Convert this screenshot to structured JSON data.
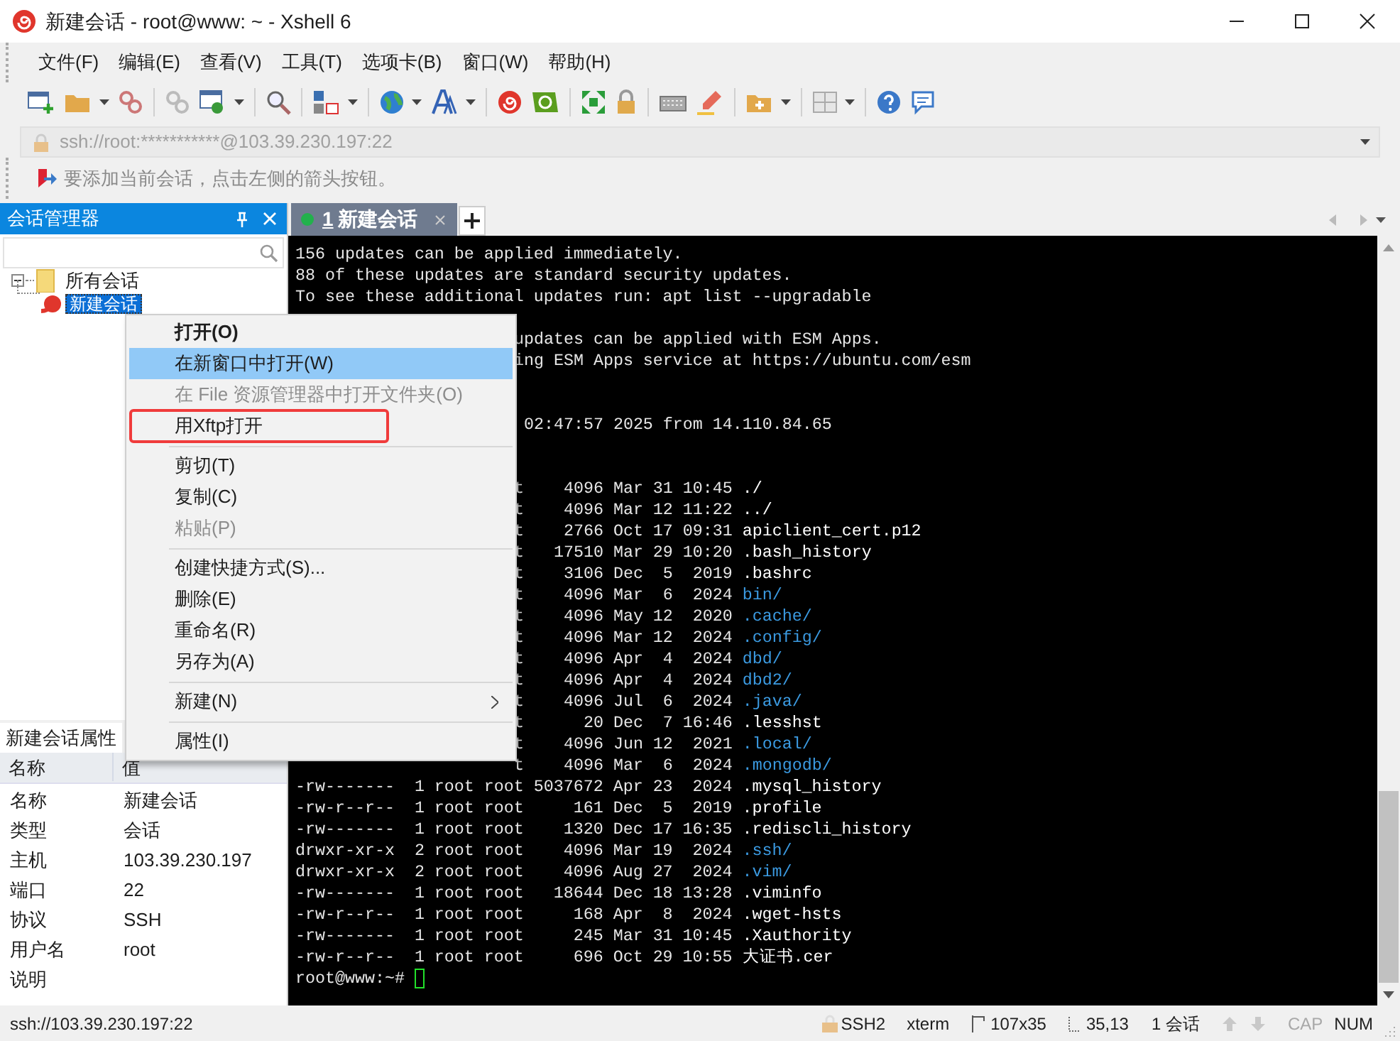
{
  "window": {
    "title": "新建会话 - root@www: ~ - Xshell 6"
  },
  "menu_bar": [
    "文件(F)",
    "编辑(E)",
    "查看(V)",
    "工具(T)",
    "选项卡(B)",
    "窗口(W)",
    "帮助(H)"
  ],
  "address_bar": {
    "value": "ssh://root:***********@103.39.230.197:22"
  },
  "hint_bar": {
    "text": "要添加当前会话，点击左侧的箭头按钮。"
  },
  "session_manager": {
    "title": "会话管理器",
    "tree": [
      {
        "label": "所有会话",
        "expanded": true,
        "selected": false,
        "children": [
          {
            "label": "新建会话",
            "selected": true
          }
        ]
      }
    ]
  },
  "properties": {
    "tab": "新建会话属性",
    "columns": [
      "名称",
      "值"
    ],
    "rows": [
      {
        "name": "名称",
        "value": "新建会话"
      },
      {
        "name": "类型",
        "value": "会话"
      },
      {
        "name": "主机",
        "value": "103.39.230.197"
      },
      {
        "name": "端口",
        "value": "22"
      },
      {
        "name": "协议",
        "value": "SSH"
      },
      {
        "name": "用户名",
        "value": "root"
      },
      {
        "name": "说明"
      }
    ]
  },
  "tabs": [
    {
      "number": "1",
      "label": "新建会话",
      "selected": true,
      "connected": true
    }
  ],
  "terminal": {
    "lines": [
      {
        "kind": "text",
        "text": "156 updates can be applied immediately."
      },
      {
        "kind": "text",
        "text": "88 of these updates are standard security updates."
      },
      {
        "kind": "text",
        "text": "To see these additional updates run: apt list --upgradable"
      },
      {
        "kind": "blank"
      },
      {
        "kind": "text",
        "text": "updates can be applied with ESM Apps.",
        "covered": true
      },
      {
        "kind": "text",
        "text": "ing ESM Apps service at https://ubuntu.com/esm",
        "covered": true
      },
      {
        "kind": "blank"
      },
      {
        "kind": "blank"
      },
      {
        "kind": "text",
        "text": " 02:47:57 2025 from 14.110.84.65",
        "covered": true
      },
      {
        "kind": "blank"
      },
      {
        "kind": "blank"
      },
      {
        "kind": "text",
        "text": "t    4096 Mar 31 10:45",
        "file": "./",
        "color": "#ffffff",
        "covered": true
      },
      {
        "kind": "text",
        "text": "t    4096 Mar 12 11:22",
        "file": "../",
        "color": "#ffffff",
        "covered": true
      },
      {
        "kind": "text",
        "text": "t    2766 Oct 17 09:31",
        "file": "apiclient_cert.p12",
        "color": "#ffffff",
        "covered": true
      },
      {
        "kind": "text",
        "text": "t   17510 Mar 29 10:20",
        "file": ".bash_history",
        "color": "#ffffff",
        "covered": true
      },
      {
        "kind": "text",
        "text": "t    3106 Dec  5  2019",
        "file": ".bashrc",
        "color": "#ffffff",
        "covered": true
      },
      {
        "kind": "text",
        "text": "t    4096 Mar  6  2024",
        "file": "bin/",
        "color": "#3b9ae1",
        "covered": true
      },
      {
        "kind": "text",
        "text": "t    4096 May 12  2020",
        "file": ".cache/",
        "color": "#3b9ae1",
        "covered": true
      },
      {
        "kind": "text",
        "text": "t    4096 Mar 12  2024",
        "file": ".config/",
        "color": "#3b9ae1",
        "covered": true
      },
      {
        "kind": "text",
        "text": "t    4096 Apr  4  2024",
        "file": "dbd/",
        "color": "#3b9ae1",
        "covered": true
      },
      {
        "kind": "text",
        "text": "t    4096 Apr  4  2024",
        "file": "dbd2/",
        "color": "#3b9ae1",
        "covered": true
      },
      {
        "kind": "text",
        "text": "t    4096 Jul  6  2024",
        "file": ".java/",
        "color": "#3b9ae1",
        "covered": true
      },
      {
        "kind": "text",
        "text": "t      20 Dec  7 16:46",
        "file": ".lesshst",
        "color": "#ffffff",
        "covered": true
      },
      {
        "kind": "text",
        "text": "t    4096 Jun 12  2021",
        "file": ".local/",
        "color": "#3b9ae1",
        "covered": true
      },
      {
        "kind": "text",
        "text": "t    4096 Mar  6  2024",
        "file": ".mongodb/",
        "color": "#3b9ae1",
        "covered": true
      },
      {
        "kind": "text",
        "text": "-rw-------  1 root root 5037672 Apr 23  2024",
        "file": ".mysql_history",
        "color": "#ffffff"
      },
      {
        "kind": "text",
        "text": "-rw-r--r--  1 root root     161 Dec  5  2019",
        "file": ".profile",
        "color": "#ffffff"
      },
      {
        "kind": "text",
        "text": "-rw-------  1 root root    1320 Dec 17 16:35",
        "file": ".rediscli_history",
        "color": "#ffffff"
      },
      {
        "kind": "text",
        "text": "drwxr-xr-x  2 root root    4096 Mar 19  2024",
        "file": ".ssh/",
        "color": "#3b9ae1"
      },
      {
        "kind": "text",
        "text": "drwxr-xr-x  2 root root    4096 Aug 27  2024",
        "file": ".vim/",
        "color": "#3b9ae1"
      },
      {
        "kind": "text",
        "text": "-rw-------  1 root root   18644 Dec 18 13:28",
        "file": ".viminfo",
        "color": "#ffffff"
      },
      {
        "kind": "text",
        "text": "-rw-r--r--  1 root root     168 Apr  8  2024",
        "file": ".wget-hsts",
        "color": "#ffffff"
      },
      {
        "kind": "text",
        "text": "-rw-------  1 root root     245 Mar 31 10:45",
        "file": ".Xauthority",
        "color": "#ffffff"
      },
      {
        "kind": "text",
        "text": "-rw-r--r--  1 root root     696 Oct 29 10:55",
        "file": "大证书.cer",
        "color": "#ffffff"
      },
      {
        "kind": "text",
        "text": "root@www:~#",
        "cursor": true
      }
    ]
  },
  "context_menu": {
    "items": [
      {
        "kind": "item",
        "label": "打开(O)",
        "default": true,
        "selected": false,
        "disabled": false
      },
      {
        "kind": "item",
        "label": "在新窗口中打开(W)",
        "default": false,
        "selected": true,
        "disabled": false
      },
      {
        "kind": "item",
        "label": "在 File 资源管理器中打开文件夹(O)",
        "default": false,
        "selected": false,
        "disabled": true
      },
      {
        "kind": "item",
        "label": "用Xftp打开",
        "default": false,
        "selected": false,
        "disabled": false,
        "marked": true
      },
      {
        "kind": "separator"
      },
      {
        "kind": "item",
        "label": "剪切(T)",
        "default": false,
        "selected": false,
        "disabled": false
      },
      {
        "kind": "item",
        "label": "复制(C)",
        "default": false,
        "selected": false,
        "disabled": false
      },
      {
        "kind": "item",
        "label": "粘贴(P)",
        "default": false,
        "selected": false,
        "disabled": true
      },
      {
        "kind": "separator"
      },
      {
        "kind": "item",
        "label": "创建快捷方式(S)...",
        "default": false,
        "selected": false,
        "disabled": false
      },
      {
        "kind": "item",
        "label": "删除(E)",
        "default": false,
        "selected": false,
        "disabled": false
      },
      {
        "kind": "item",
        "label": "重命名(R)",
        "default": false,
        "selected": false,
        "disabled": false
      },
      {
        "kind": "item",
        "label": "另存为(A)",
        "default": false,
        "selected": false,
        "disabled": false
      },
      {
        "kind": "separator"
      },
      {
        "kind": "item",
        "label": "新建(N)",
        "default": false,
        "selected": false,
        "disabled": false,
        "submenu": true
      },
      {
        "kind": "separator"
      },
      {
        "kind": "item",
        "label": "属性(I)",
        "default": false,
        "selected": false,
        "disabled": false
      }
    ]
  },
  "status_bar": {
    "address": "ssh://103.39.230.197:22",
    "protocol": "SSH2",
    "terminal_type": "xterm",
    "size": "107x35",
    "cursor": "35,13",
    "sessions": "1 会话",
    "indicators": [
      {
        "label": "CAP",
        "on": false
      },
      {
        "label": "NUM",
        "on": true
      }
    ]
  }
}
